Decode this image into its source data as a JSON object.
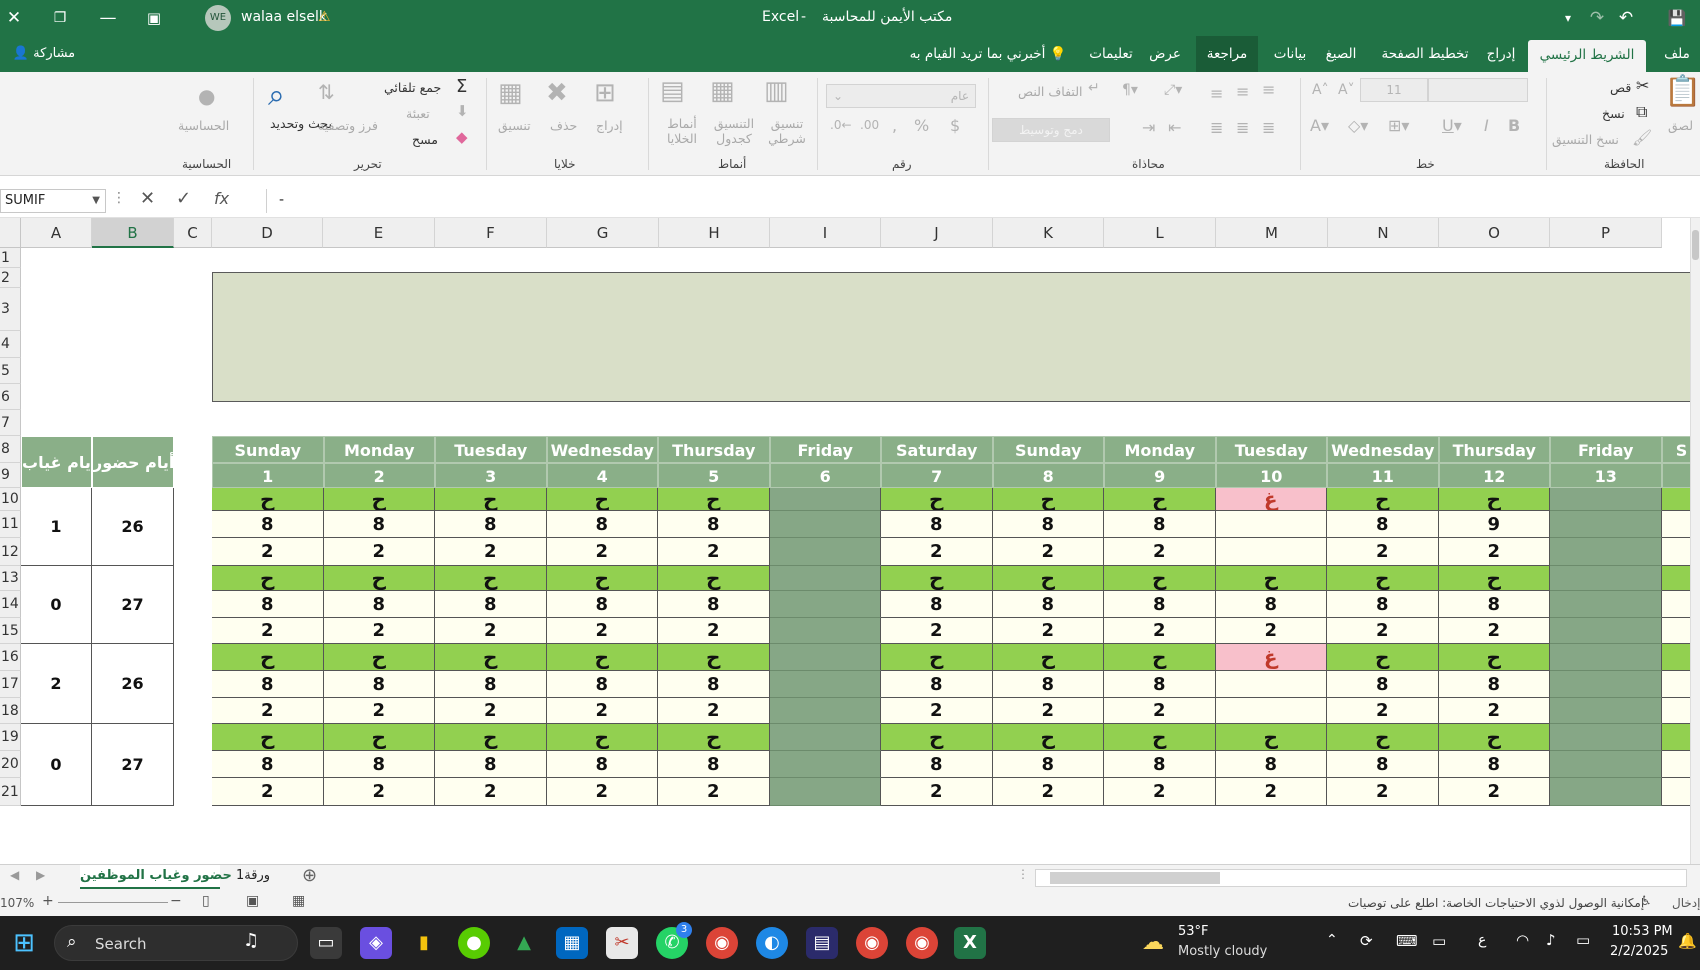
{
  "window": {
    "app_name": "Excel",
    "doc_title": "مكتب الأيمن للمحاسبة",
    "separator": "-",
    "user_name": "walaa elselk",
    "user_initials": "WE",
    "warning_icon": "warning-icon"
  },
  "tabs": [
    "ملف",
    "الشريط الرئيسي",
    "إدراج",
    "تخطيط الصفحة",
    "الصيغ",
    "بيانات",
    "مراجعة",
    "عرض",
    "تعليمات"
  ],
  "tell_me": "أخبرني بما تريد القيام به",
  "share_label": "مشاركة",
  "ribbon": {
    "clipboard": {
      "label": "الحافظة",
      "paste": "لصق",
      "cut": "قص",
      "copy": "نسخ",
      "format_painter": "نسخ التنسيق"
    },
    "font": {
      "label": "خط",
      "size": "11"
    },
    "alignment": {
      "label": "محاذاة",
      "wrap": "التفاف النص",
      "merge": "دمج وتوسيط"
    },
    "number": {
      "label": "رقم",
      "format": "عام"
    },
    "styles": {
      "label": "أنماط",
      "conditional": "تنسيق شرطي",
      "table": "التنسيق كجدول",
      "cell_styles": "أنماط الخلايا"
    },
    "cells": {
      "label": "خلايا",
      "insert": "إدراج",
      "delete": "حذف",
      "format": "تنسيق"
    },
    "editing": {
      "label": "تحرير",
      "autosum": "جمع تلقائي",
      "fill": "تعبئة",
      "clear": "مسح",
      "sort": "فرز وتصفية",
      "find": "بحث وتحديد"
    },
    "analysis": {
      "label": "الحساسية",
      "button": "الحساسية"
    }
  },
  "formula_bar": {
    "name_box": "SUMIF",
    "content": "-"
  },
  "columns": [
    "A",
    "B",
    "C",
    "D",
    "E",
    "F",
    "G",
    "H",
    "I",
    "J",
    "K",
    "L",
    "M",
    "N",
    "O",
    "P"
  ],
  "rows": [
    "1",
    "2",
    "3",
    "4",
    "5",
    "6",
    "7",
    "8",
    "9",
    "10",
    "11",
    "12",
    "13",
    "14",
    "15",
    "16",
    "17",
    "18",
    "19",
    "20",
    "21"
  ],
  "side_headers": {
    "absence": "أيام غياب",
    "presence": "أيام حضور"
  },
  "days": [
    "Sunday",
    "Monday",
    "Tuesday",
    "Wednesday",
    "Thursday",
    "Friday",
    "Saturday",
    "Sunday",
    "Monday",
    "Tuesday",
    "Wednesday",
    "Thursday",
    "Friday"
  ],
  "dates": [
    "1",
    "2",
    "3",
    "4",
    "5",
    "6",
    "7",
    "8",
    "9",
    "10",
    "11",
    "12",
    "13"
  ],
  "extra_day_partial": "S",
  "employees": [
    {
      "absence": "1",
      "presence": "26",
      "marks": [
        "ح",
        "ح",
        "ح",
        "ح",
        "ح",
        "",
        "ح",
        "ح",
        "ح",
        "غ",
        "ح",
        "ح",
        ""
      ],
      "hours": [
        "8",
        "8",
        "8",
        "8",
        "8",
        "",
        "8",
        "8",
        "8",
        "",
        "8",
        "9",
        ""
      ],
      "extra": [
        "2",
        "2",
        "2",
        "2",
        "2",
        "",
        "2",
        "2",
        "2",
        "",
        "2",
        "2",
        ""
      ]
    },
    {
      "absence": "0",
      "presence": "27",
      "marks": [
        "ح",
        "ح",
        "ح",
        "ح",
        "ح",
        "",
        "ح",
        "ح",
        "ح",
        "ح",
        "ح",
        "ح",
        ""
      ],
      "hours": [
        "8",
        "8",
        "8",
        "8",
        "8",
        "",
        "8",
        "8",
        "8",
        "8",
        "8",
        "8",
        ""
      ],
      "extra": [
        "2",
        "2",
        "2",
        "2",
        "2",
        "",
        "2",
        "2",
        "2",
        "2",
        "2",
        "2",
        ""
      ]
    },
    {
      "absence": "2",
      "presence": "26",
      "marks": [
        "ح",
        "ح",
        "ح",
        "ح",
        "ح",
        "",
        "ح",
        "ح",
        "ح",
        "غ",
        "ح",
        "ح",
        ""
      ],
      "hours": [
        "8",
        "8",
        "8",
        "8",
        "8",
        "",
        "8",
        "8",
        "8",
        "",
        "8",
        "8",
        ""
      ],
      "extra": [
        "2",
        "2",
        "2",
        "2",
        "2",
        "",
        "2",
        "2",
        "2",
        "",
        "2",
        "2",
        ""
      ]
    },
    {
      "absence": "0",
      "presence": "27",
      "marks": [
        "ح",
        "ح",
        "ح",
        "ح",
        "ح",
        "",
        "ح",
        "ح",
        "ح",
        "ح",
        "ح",
        "ح",
        ""
      ],
      "hours": [
        "8",
        "8",
        "8",
        "8",
        "8",
        "",
        "8",
        "8",
        "8",
        "8",
        "8",
        "8",
        ""
      ],
      "extra": [
        "2",
        "2",
        "2",
        "2",
        "2",
        "",
        "2",
        "2",
        "2",
        "2",
        "2",
        "2",
        ""
      ]
    }
  ],
  "sheets": [
    "حضور وغياب الموظفين",
    "ورقة1"
  ],
  "status": {
    "accessibility": "إمكانية الوصول لذوي الاحتياجات الخاصة: اطلع على توصيات",
    "mode": "إدخال",
    "zoom": "107%"
  },
  "taskbar": {
    "search": "Search",
    "weather_temp": "53°F",
    "weather_desc": "Mostly cloudy",
    "time": "10:53 PM",
    "date": "2/2/2025",
    "lang": "ع",
    "notif_badge": "3"
  },
  "colors": {
    "excel_green": "#217346",
    "header_green": "#8aaf88",
    "present_green": "#92d050",
    "absent_pink": "#f8c0cb",
    "banner": "#d9dfc8"
  }
}
